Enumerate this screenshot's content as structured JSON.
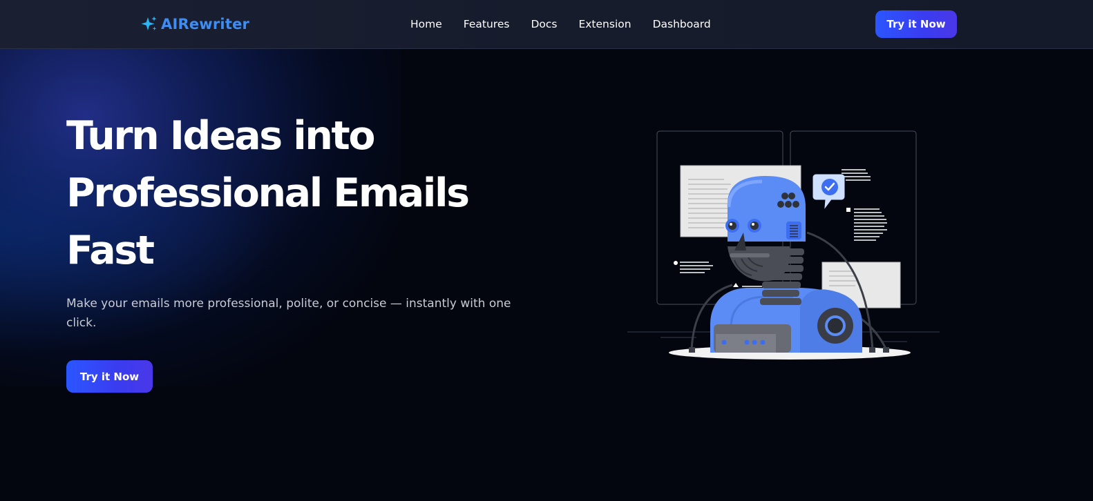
{
  "header": {
    "logo_text": "AIRewriter",
    "logo_icon": "sparkles-icon",
    "nav": [
      {
        "label": "Home"
      },
      {
        "label": "Features"
      },
      {
        "label": "Docs"
      },
      {
        "label": "Extension"
      },
      {
        "label": "Dashboard"
      }
    ],
    "cta_label": "Try it Now"
  },
  "hero": {
    "title_line1": "Turn Ideas into",
    "title_line2": "Professional Emails",
    "title_line3": "Fast",
    "subtitle": "Make your emails more professional, polite, or concise — instantly with one click.",
    "cta_label": "Try it Now",
    "illustration": "robot-writing-illustration"
  },
  "colors": {
    "background": "#03060f",
    "header_bg": "#161c2c",
    "accent": "#2b56ff",
    "logo": "#3d8df2",
    "robot_blue": "#5b8cf5"
  }
}
